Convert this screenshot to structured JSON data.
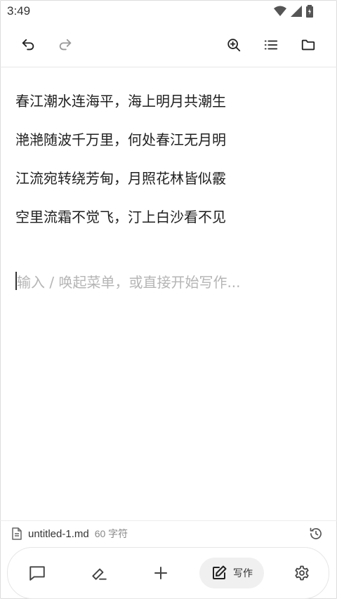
{
  "status_bar": {
    "time": "3:49"
  },
  "editor": {
    "lines": [
      "春江潮水连海平，海上明月共潮生",
      "滟滟随波千万里，何处春江无月明",
      "江流宛转绕芳甸，月照花林皆似霰",
      "空里流霜不觉飞，汀上白沙看不见"
    ],
    "placeholder": "输入 / 唤起菜单，或直接开始写作..."
  },
  "footer": {
    "file_name": "untitled-1.md",
    "char_count": "60 字符"
  },
  "bottom_nav": {
    "write_label": "写作"
  },
  "icons": [
    "undo-icon",
    "redo-icon",
    "zoom-icon",
    "list-icon",
    "folder-icon",
    "document-icon",
    "history-icon",
    "comment-icon",
    "pen-icon",
    "plus-icon",
    "edit-icon",
    "gear-icon"
  ]
}
